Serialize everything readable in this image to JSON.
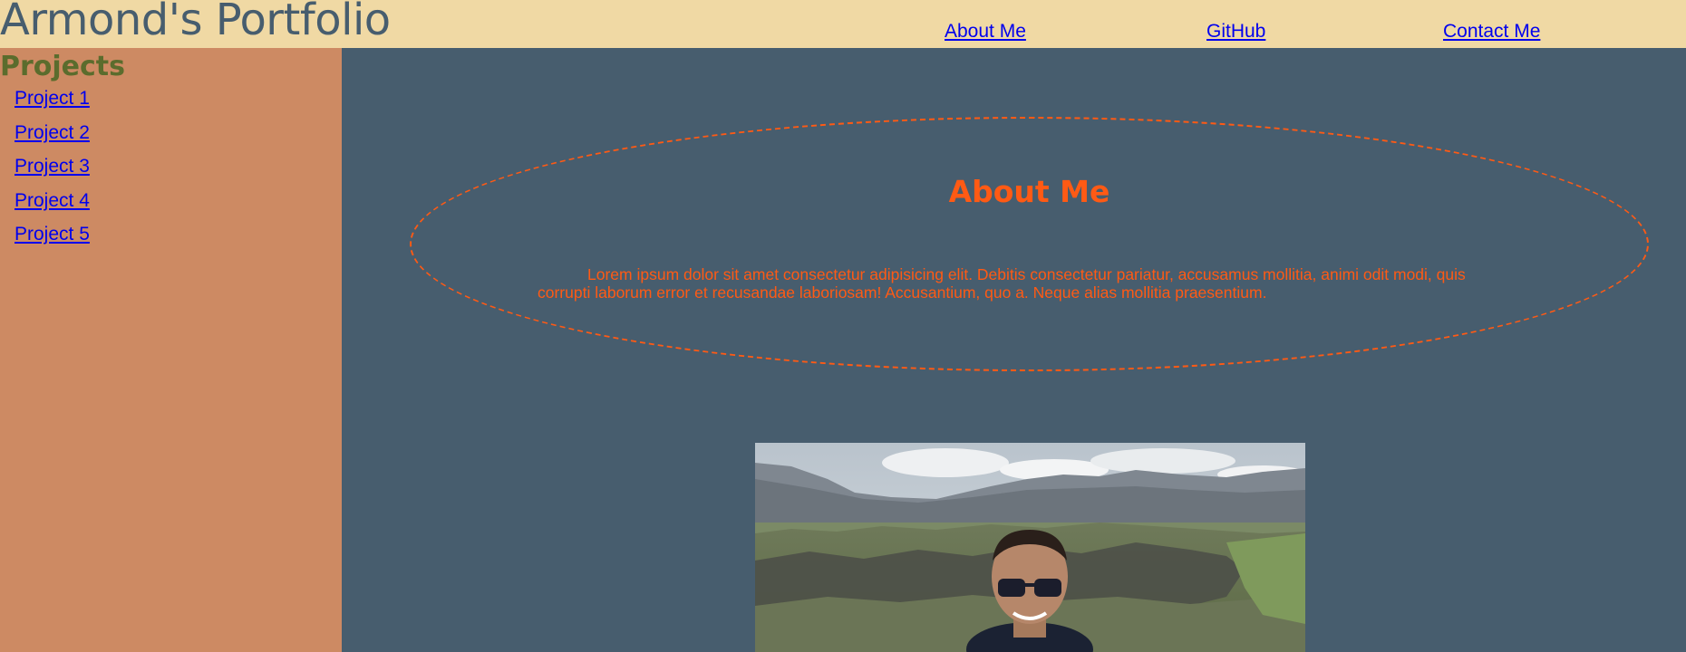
{
  "header": {
    "title": "Armond's Portfolio",
    "nav": [
      {
        "label": "About Me"
      },
      {
        "label": "GitHub"
      },
      {
        "label": "Contact Me"
      }
    ],
    "background": "#f0d9a4"
  },
  "sidebar": {
    "heading": "Projects",
    "items": [
      {
        "label": "Project 1"
      },
      {
        "label": "Project 2"
      },
      {
        "label": "Project 3"
      },
      {
        "label": "Project 4"
      },
      {
        "label": "Project 5"
      }
    ],
    "background": "#cd8a63"
  },
  "about": {
    "title": "About Me",
    "text": "Lorem ipsum dolor sit amet consectetur adipisicing elit. Debitis consectetur pariatur, accusamus mollitia, animi odit modi, quis corrupti laborum error et recusandae laboriosam! Accusantium, quo a. Neque alias mollitia praesentium.",
    "accent": "#ff5a14"
  },
  "main": {
    "background": "#475d6e"
  },
  "colors": {
    "link": "#0000ee",
    "title": "#475d6e",
    "sidebar_heading": "#5b6c2d"
  }
}
